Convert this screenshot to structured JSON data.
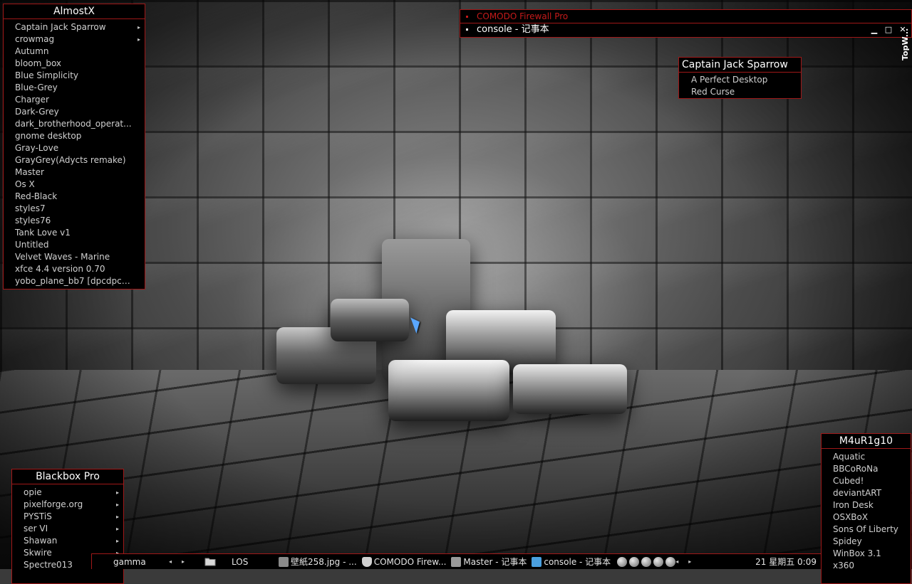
{
  "menus": {
    "almostx": {
      "title": "AlmostX",
      "items": [
        {
          "label": "Captain Jack Sparrow",
          "submenu": true
        },
        {
          "label": "crowmag",
          "submenu": true
        },
        {
          "label": "Autumn"
        },
        {
          "label": "bloom_box"
        },
        {
          "label": "Blue Simplicity"
        },
        {
          "label": "Blue-Grey"
        },
        {
          "label": "Charger"
        },
        {
          "label": "Dark-Grey"
        },
        {
          "label": "dark_brotherhood_operat..."
        },
        {
          "label": "gnome desktop"
        },
        {
          "label": "Gray-Love"
        },
        {
          "label": "GrayGrey(Adycts remake)"
        },
        {
          "label": "Master"
        },
        {
          "label": "Os X"
        },
        {
          "label": "Red-Black"
        },
        {
          "label": "styles7"
        },
        {
          "label": "styles76"
        },
        {
          "label": "Tank Love v1"
        },
        {
          "label": "Untitled"
        },
        {
          "label": "Velvet Waves - Marine"
        },
        {
          "label": "xfce 4.4 version 0.70"
        },
        {
          "label": "yobo_plane_bb7 [dpcdpc1..."
        }
      ]
    },
    "captain_jack": {
      "title": "Captain Jack Sparrow",
      "items": [
        {
          "label": "A Perfect Desktop"
        },
        {
          "label": "Red Curse"
        }
      ]
    },
    "blackbox_pro": {
      "title": "Blackbox Pro",
      "items": [
        {
          "label": "opie",
          "submenu": true
        },
        {
          "label": "pixelforge.org",
          "submenu": true
        },
        {
          "label": "PYSTiS",
          "submenu": true
        },
        {
          "label": "ser VI",
          "submenu": true
        },
        {
          "label": "Shawan",
          "submenu": true
        },
        {
          "label": "Skwire",
          "submenu": true
        },
        {
          "label": "Spectre013"
        }
      ]
    },
    "m4ur1g10": {
      "title": "M4uR1g10",
      "items": [
        {
          "label": "Aquatic"
        },
        {
          "label": "BBCoRoNa"
        },
        {
          "label": "Cubed!"
        },
        {
          "label": "deviantART"
        },
        {
          "label": "Iron Desk"
        },
        {
          "label": "OSXBoX"
        },
        {
          "label": "Sons Of Liberty"
        },
        {
          "label": "Spidey"
        },
        {
          "label": "WinBox 3.1"
        },
        {
          "label": "x360"
        }
      ]
    }
  },
  "windows": {
    "comodo": "COMODO Firewall Pro",
    "console": "console - 记事本",
    "controls": {
      "minimize": "▁",
      "maximize": "□",
      "close": "✕"
    },
    "topwin_label": "TopW..."
  },
  "taskbar": {
    "workspace": "gamma",
    "prev_arrow": "◂",
    "next_arrow": "▸",
    "folder_icon": "folder-icon",
    "workspace2": "LOS",
    "tasks": [
      {
        "label": "壁紙258.jpg - ...",
        "icon_color": "#8a8a8a"
      },
      {
        "label": "COMODO Firew...",
        "icon_color": "#d0d0d0"
      },
      {
        "label": "Master - 记事本",
        "icon_color": "#9a9a9a"
      },
      {
        "label": "console - 记事本",
        "icon_color": "#4aa0e0"
      }
    ],
    "tray_prev": "◂",
    "tray_next": "▸",
    "clock": "21 星期五 0:09"
  },
  "colors": {
    "accent": "#a01818",
    "comodo_text": "#c41a1a",
    "cursor": "#5aa7ff"
  }
}
